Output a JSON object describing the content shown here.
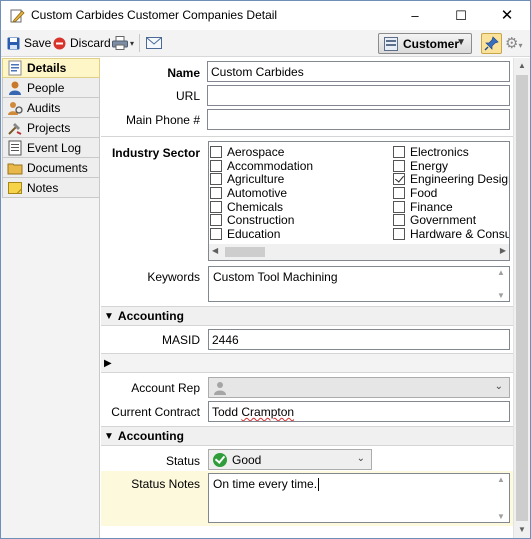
{
  "window": {
    "title": "Custom Carbides Customer Companies Detail",
    "controls": {
      "minimize": "–",
      "maximize": "☐",
      "close": "✕"
    }
  },
  "toolbar": {
    "save_label": "Save",
    "discard_label": "Discard",
    "view_selector": "Customer"
  },
  "sidebar": {
    "items": [
      {
        "label": "Details",
        "icon": "details-icon",
        "active": true
      },
      {
        "label": "People",
        "icon": "people-icon"
      },
      {
        "label": "Audits",
        "icon": "audits-icon"
      },
      {
        "label": "Projects",
        "icon": "projects-icon"
      },
      {
        "label": "Event Log",
        "icon": "event-log-icon"
      },
      {
        "label": "Documents",
        "icon": "documents-icon"
      },
      {
        "label": "Notes",
        "icon": "notes-icon"
      }
    ]
  },
  "form": {
    "name_label": "Name",
    "name_value": "Custom Carbides",
    "url_label": "URL",
    "url_value": "",
    "phone_label": "Main Phone #",
    "phone_value": "",
    "industry_label": "Industry Sector",
    "industry_col1": [
      {
        "label": "Aerospace",
        "checked": false
      },
      {
        "label": "Accommodation",
        "checked": false
      },
      {
        "label": "Agriculture",
        "checked": false
      },
      {
        "label": "Automotive",
        "checked": false
      },
      {
        "label": "Chemicals",
        "checked": false
      },
      {
        "label": "Construction",
        "checked": false
      },
      {
        "label": "Education",
        "checked": false
      }
    ],
    "industry_col2": [
      {
        "label": "Electronics",
        "checked": false
      },
      {
        "label": "Energy",
        "checked": false
      },
      {
        "label": "Engineering Design",
        "checked": true
      },
      {
        "label": "Food",
        "checked": false
      },
      {
        "label": "Finance",
        "checked": false
      },
      {
        "label": "Government",
        "checked": false
      },
      {
        "label": "Hardware & Consum",
        "checked": false
      }
    ],
    "keywords_label": "Keywords",
    "keywords_value": "Custom Tool Machining",
    "section1_title": "Accounting",
    "masid_label": "MASID",
    "masid_value": "2446",
    "account_rep_label": "Account Rep",
    "account_rep_value": "",
    "contract_label": "Current Contract",
    "contract_first": "Todd ",
    "contract_last": "Crampton",
    "section2_title": "Accounting",
    "status_label": "Status",
    "status_value": "Good",
    "status_notes_label": "Status Notes",
    "status_notes_value": "On time every time."
  },
  "colors": {
    "active_tab_bg": "#fff6c8",
    "status_good": "#2e9d3a",
    "notes_row_bg": "#fdf9dc"
  }
}
